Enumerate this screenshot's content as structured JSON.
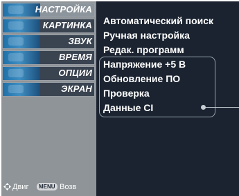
{
  "sidebar": {
    "items": [
      {
        "label": "НАСТРОЙКА",
        "icon": "antenna-setup-icon",
        "selected": true
      },
      {
        "label": "КАРТИНКА",
        "icon": "picture-icon",
        "selected": false
      },
      {
        "label": "ЗВУК",
        "icon": "sound-icon",
        "selected": false
      },
      {
        "label": "ВРЕМЯ",
        "icon": "clock-icon",
        "selected": false
      },
      {
        "label": "ОПЦИИ",
        "icon": "options-icon",
        "selected": false
      },
      {
        "label": "ЭКРАН",
        "icon": "screen-icon",
        "selected": false
      }
    ]
  },
  "footer": {
    "nav_label": "Двиг",
    "menu_key": "MENU",
    "back_label": "Возв"
  },
  "submenu": {
    "items": [
      {
        "label": "Автоматический поиск"
      },
      {
        "label": "Ручная настройка"
      },
      {
        "label": "Редак. программ"
      },
      {
        "label": "Напряжение +5 В"
      },
      {
        "label": "Обновление ПО"
      },
      {
        "label": "Проверка"
      },
      {
        "label": "Данные CI"
      }
    ]
  },
  "colors": {
    "background": "#1b2330",
    "sidebar": "#8e9498",
    "selected_item": "#8c949c",
    "text": "#ffffff"
  }
}
